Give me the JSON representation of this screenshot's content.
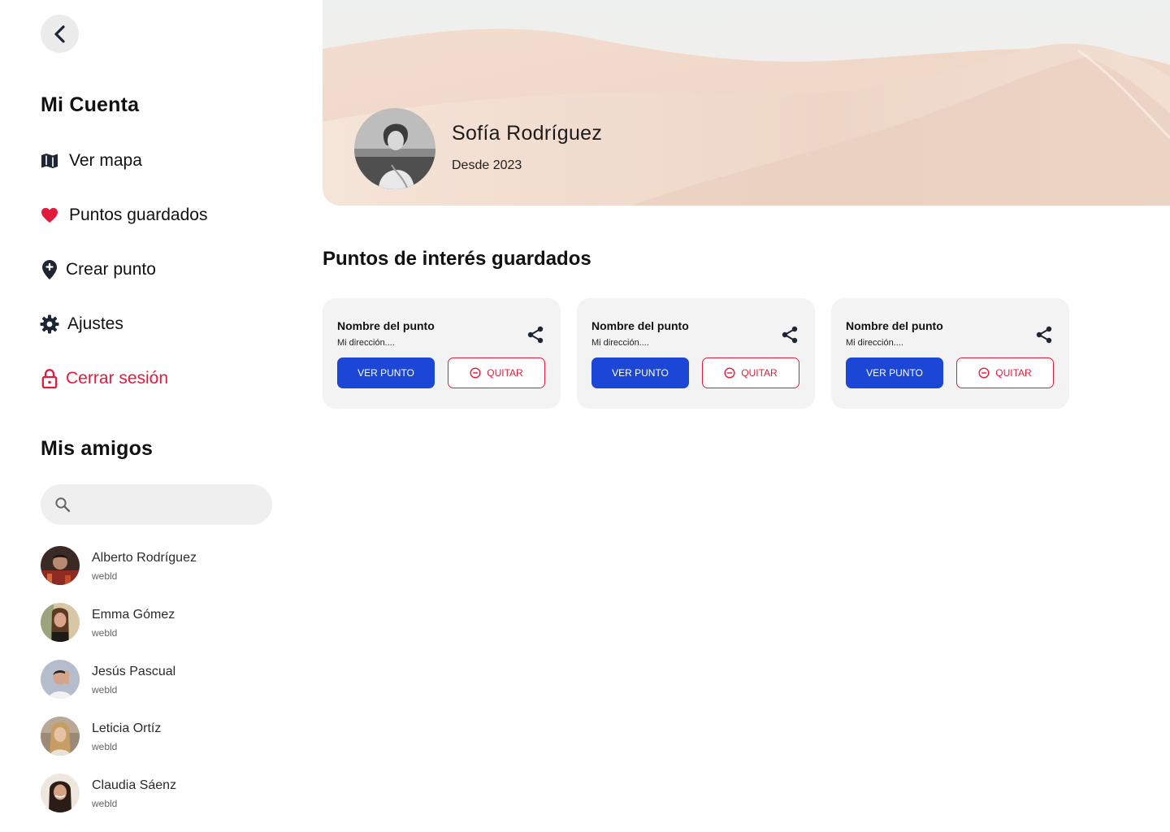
{
  "sidebar": {
    "account_title": "Mi Cuenta",
    "menu": [
      {
        "label": "Ver mapa",
        "icon": "map-icon"
      },
      {
        "label": "Puntos guardados",
        "icon": "heart-icon"
      },
      {
        "label": "Crear punto",
        "icon": "add-location-icon"
      },
      {
        "label": "Ajustes",
        "icon": "gear-icon"
      },
      {
        "label": "Cerrar sesión",
        "icon": "lock-icon"
      }
    ],
    "friends_title": "Mis amigos",
    "search": {
      "placeholder": "",
      "value": ""
    },
    "friends": [
      {
        "name": "Alberto Rodríguez",
        "sub": "webld"
      },
      {
        "name": "Emma Gómez",
        "sub": "webld"
      },
      {
        "name": "Jesús Pascual",
        "sub": "webld"
      },
      {
        "name": "Leticia Ortíz",
        "sub": "webld"
      },
      {
        "name": "Claudia Sáenz",
        "sub": "webld"
      }
    ]
  },
  "profile": {
    "name": "Sofía Rodríguez",
    "since": "Desde 2023"
  },
  "saved": {
    "title": "Puntos de interés guardados",
    "cards": [
      {
        "name": "Nombre del punto",
        "address": "Mi dirección....",
        "view_label": "VER PUNTO",
        "remove_label": "QUITAR"
      },
      {
        "name": "Nombre del punto",
        "address": "Mi dirección....",
        "view_label": "VER PUNTO",
        "remove_label": "QUITAR"
      },
      {
        "name": "Nombre del punto",
        "address": "Mi dirección....",
        "view_label": "VER PUNTO",
        "remove_label": "QUITAR"
      }
    ]
  },
  "colors": {
    "primary": "#1c47d6",
    "danger": "#e21b3c",
    "card_bg": "#f3f3f3",
    "search_bg": "#efefef"
  }
}
